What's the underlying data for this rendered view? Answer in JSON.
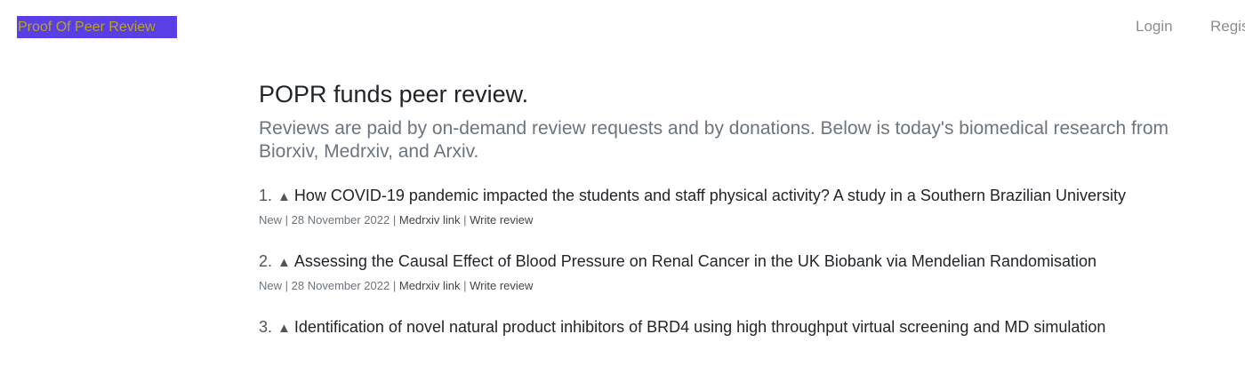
{
  "header": {
    "brand": "Proof Of Peer Review",
    "nav": {
      "login": "Login",
      "register": "Register"
    }
  },
  "main": {
    "title": "POPR funds peer review.",
    "lead": "Reviews are paid by on-demand review requests and by donations. Below is today's biomedical research from Biorxiv, Medrxiv, and Arxiv."
  },
  "articles": [
    {
      "num": "1.",
      "title": "How COVID-19 pandemic impacted the students and staff physical activity? A study in a Southern Brazilian University",
      "status": "New",
      "date": "28 November 2022",
      "source_link": "Medrxiv link",
      "review_link": "Write review"
    },
    {
      "num": "2.",
      "title": "Assessing the Causal Effect of Blood Pressure on Renal Cancer in the UK Biobank via Mendelian Randomisation",
      "status": "New",
      "date": "28 November 2022",
      "source_link": "Medrxiv link",
      "review_link": "Write review"
    },
    {
      "num": "3.",
      "title": "Identification of novel natural product inhibitors of BRD4 using high throughput virtual screening and MD simulation",
      "status": "",
      "date": "",
      "source_link": "",
      "review_link": ""
    }
  ],
  "icons": {
    "upvote": "triangle-up-icon"
  },
  "colors": {
    "brand_bg": "#5b3fe6",
    "brand_text": "#b5a41c",
    "nav_text": "#8d8d8d",
    "lead_text": "#6c757d"
  }
}
